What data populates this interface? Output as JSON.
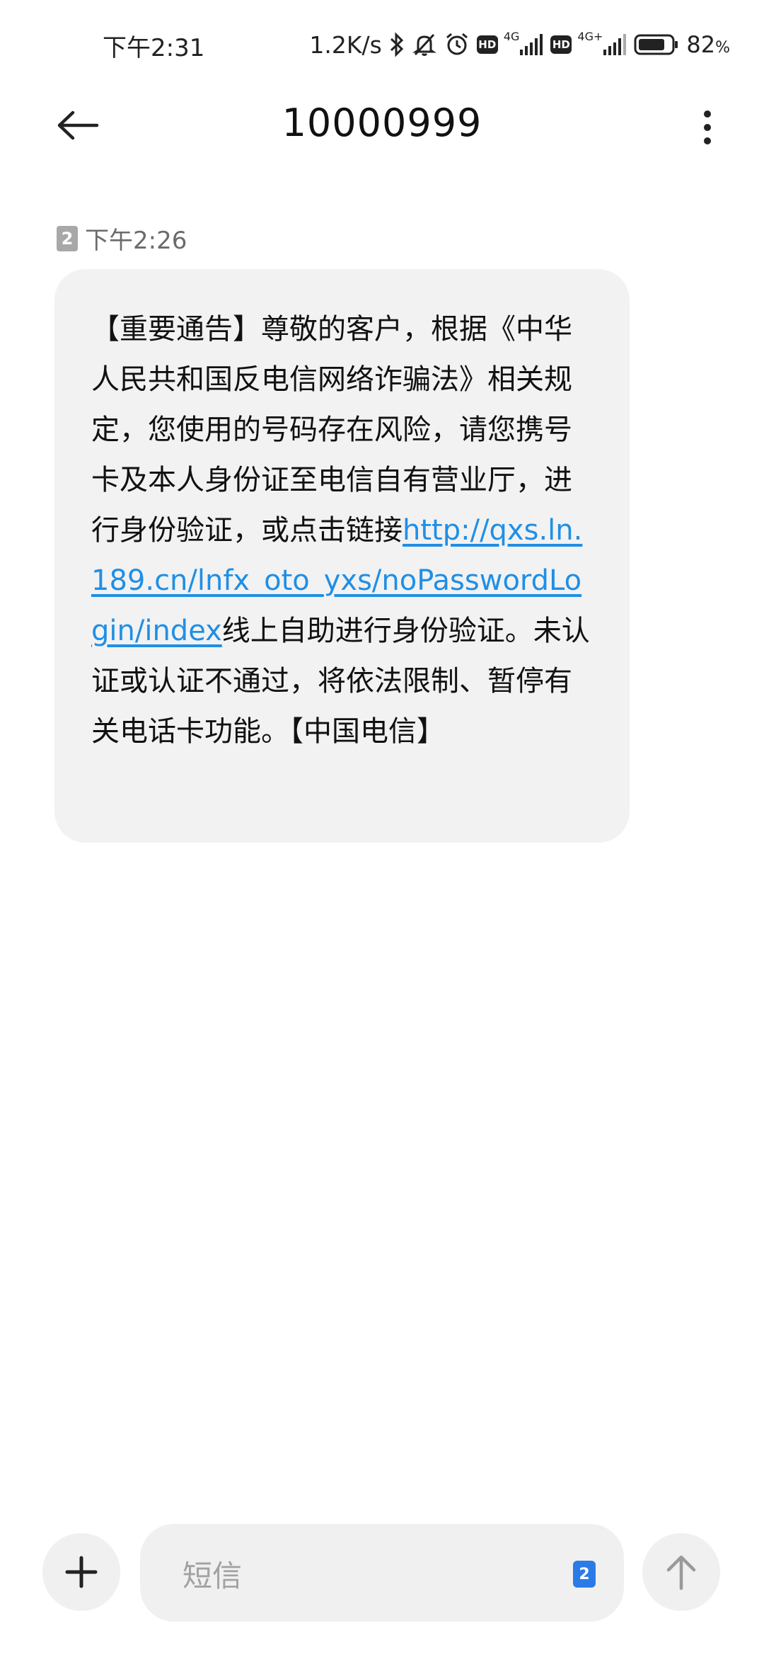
{
  "status_bar": {
    "time": "下午2:31",
    "net_speed": "1.2K/s",
    "sim1_network": "4G",
    "sim2_network": "4G+",
    "hd_label": "HD",
    "battery_level": "82",
    "battery_unit": "%"
  },
  "header": {
    "title": "10000999"
  },
  "message": {
    "sim_slot": "2",
    "time": "下午2:26",
    "text_before_link": "【重要通告】尊敬的客户，根据《中华人民共和国反电信网络诈骗法》相关规定，您使用的号码存在风险，请您携号卡及本人身份证至电信自有营业厅，进行身份验证，或点击链接",
    "link": "http://qxs.ln.189.cn/lnfx_oto_yxs/noPasswordLogin/index",
    "text_after_link": "线上自助进行身份验证。未认证或认证不通过，将依法限制、暂停有关电话卡功能。【中国电信】"
  },
  "composer": {
    "placeholder": "短信",
    "sim_slot": "2"
  },
  "colors": {
    "link": "#1f8fe6",
    "bubble": "#f2f2f2",
    "sim_select": "#2b7be6"
  },
  "icons": [
    "back-arrow-icon",
    "more-vertical-icon",
    "bluetooth-icon",
    "mute-icon",
    "alarm-icon",
    "signal-icon",
    "battery-icon",
    "plus-icon",
    "send-arrow-icon"
  ]
}
